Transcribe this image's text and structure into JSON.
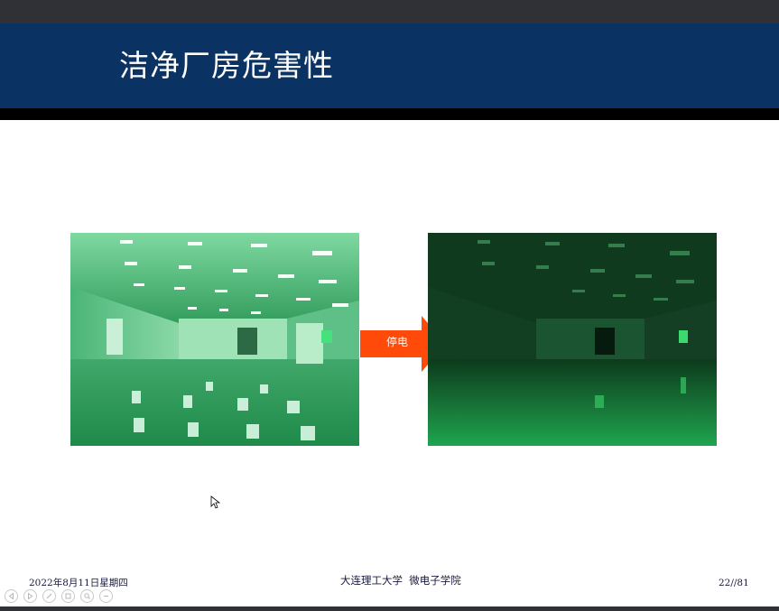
{
  "slide": {
    "title": "洁净厂房危害性",
    "arrow_label": "停电",
    "images": [
      {
        "name": "cleanroom-lights-on",
        "alt": ""
      },
      {
        "name": "cleanroom-lights-off",
        "alt": ""
      }
    ]
  },
  "footer": {
    "date": "2022年8月11日星期四",
    "center": "大连理工大学  微电子学院",
    "page": "22//81"
  },
  "toolbar": {
    "buttons": [
      {
        "icon": "previous-icon"
      },
      {
        "icon": "next-icon"
      },
      {
        "icon": "pen-icon"
      },
      {
        "icon": "slides-icon"
      },
      {
        "icon": "zoom-icon"
      },
      {
        "icon": "more-icon"
      }
    ]
  },
  "colors": {
    "title_band": "#0a3363",
    "arrow": "#ff4a0a",
    "chrome": "#2f3136"
  }
}
